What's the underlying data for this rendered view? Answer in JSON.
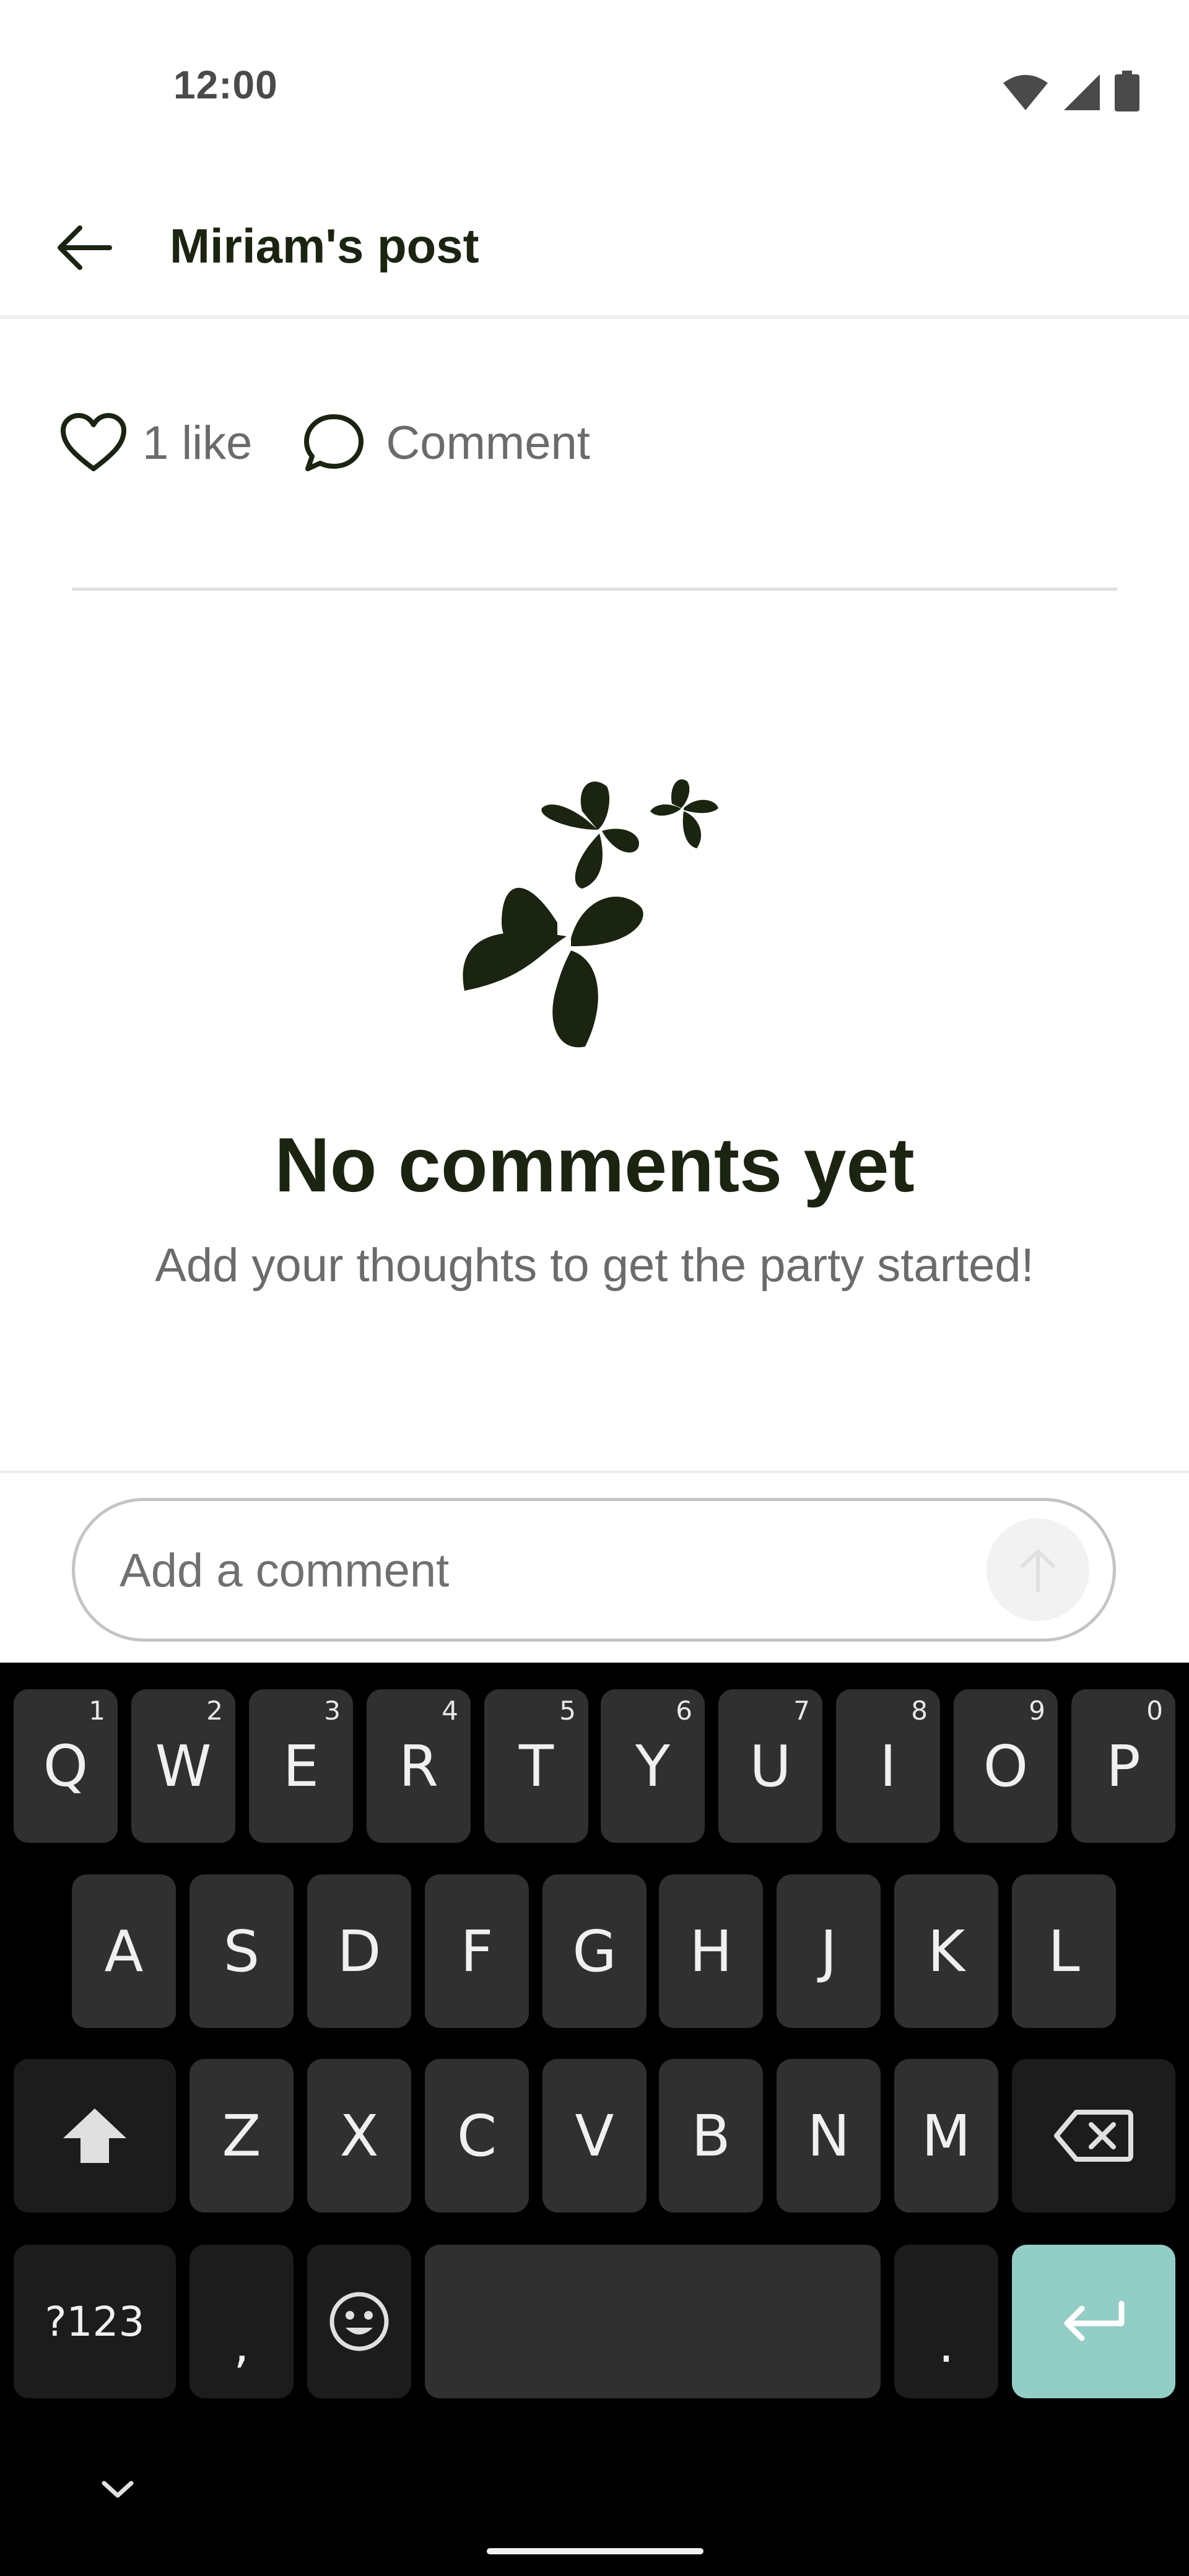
{
  "status_bar": {
    "time": "12:00",
    "icons": [
      "wifi-icon",
      "cellular-signal-icon",
      "battery-icon"
    ]
  },
  "app_bar": {
    "title": "Miriam's post",
    "back_icon": "arrow-left-icon"
  },
  "actions": {
    "like_icon": "heart-outline-icon",
    "like_label": "1 like",
    "comment_icon": "speech-bubble-icon",
    "comment_label": "Comment"
  },
  "empty_state": {
    "illustration": "butterflies-illustration",
    "title": "No comments yet",
    "subtitle": "Add your thoughts to get the party started!"
  },
  "composer": {
    "placeholder": "Add a comment",
    "value": "",
    "send_icon": "arrow-up-icon"
  },
  "keyboard": {
    "row1": [
      {
        "label": "Q",
        "hint": "1"
      },
      {
        "label": "W",
        "hint": "2"
      },
      {
        "label": "E",
        "hint": "3"
      },
      {
        "label": "R",
        "hint": "4"
      },
      {
        "label": "T",
        "hint": "5"
      },
      {
        "label": "Y",
        "hint": "6"
      },
      {
        "label": "U",
        "hint": "7"
      },
      {
        "label": "I",
        "hint": "8"
      },
      {
        "label": "O",
        "hint": "9"
      },
      {
        "label": "P",
        "hint": "0"
      }
    ],
    "row2": [
      "A",
      "S",
      "D",
      "F",
      "G",
      "H",
      "J",
      "K",
      "L"
    ],
    "row3": [
      "Z",
      "X",
      "C",
      "V",
      "B",
      "N",
      "M"
    ],
    "symbols_label": "?123",
    "comma_label": ",",
    "period_label": ".",
    "shift_icon": "shift-icon",
    "backspace_icon": "backspace-icon",
    "emoji_icon": "emoji-icon",
    "enter_icon": "enter-icon",
    "hide_icon": "chevron-down-icon"
  },
  "colors": {
    "primary_text": "#1b2410",
    "secondary_text": "#6b6b6b",
    "keyboard_bg": "#000000",
    "key_bg": "#303030",
    "enter_key_bg": "#92cdc6"
  }
}
